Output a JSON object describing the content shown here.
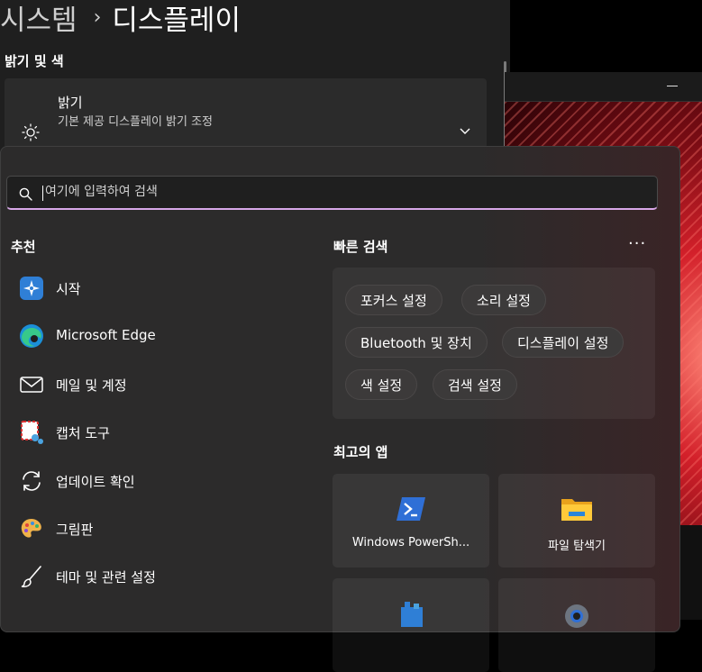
{
  "settings": {
    "breadcrumb": {
      "parent": "시스템",
      "separator": "›",
      "current": "디스플레이"
    },
    "section_title": "밝기 및 색",
    "brightness": {
      "title": "밝기",
      "subtitle": "기본 제공 디스플레이 밝기 조정"
    }
  },
  "startmenu": {
    "search": {
      "placeholder": "여기에 입력하여 검색"
    },
    "recommended": {
      "title": "추천",
      "items": [
        {
          "label": "시작",
          "icon": "start-tips-icon"
        },
        {
          "label": "Microsoft Edge",
          "icon": "edge-icon"
        },
        {
          "label": "메일 및 계정",
          "icon": "mail-icon"
        },
        {
          "label": "캡처 도구",
          "icon": "snipping-tool-icon"
        },
        {
          "label": "업데이트 확인",
          "icon": "update-icon"
        },
        {
          "label": "그림판",
          "icon": "paint-icon"
        },
        {
          "label": "테마 및 관련 설정",
          "icon": "brush-icon"
        }
      ]
    },
    "quick_search": {
      "title": "빠른 검색",
      "more": "···",
      "chips": [
        "포커스 설정",
        "소리 설정",
        "Bluetooth 및 장치",
        "디스플레이 설정",
        "색 설정",
        "검색 설정"
      ]
    },
    "top_apps": {
      "title": "최고의 앱",
      "apps": [
        {
          "label": "Windows PowerSh...",
          "icon": "powershell-icon"
        },
        {
          "label": "파일 탐색기",
          "icon": "folder-icon"
        }
      ]
    }
  },
  "colors": {
    "accent": "#d8a8e8",
    "menu_bg": "#2c2b2b"
  }
}
